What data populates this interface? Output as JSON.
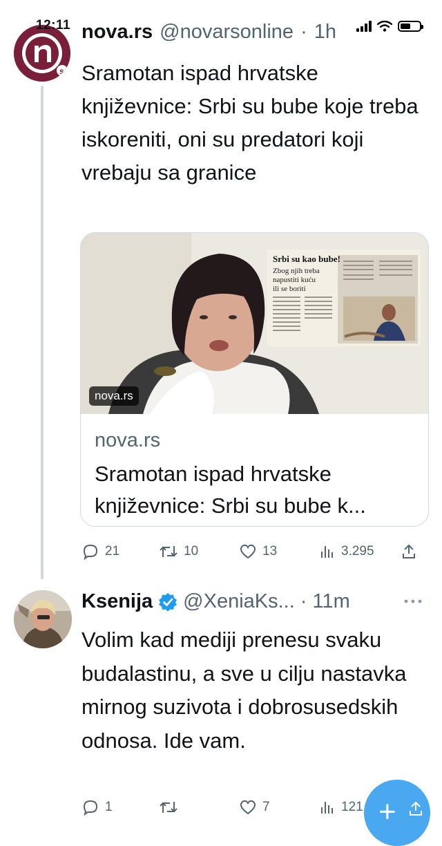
{
  "status_bar": {
    "time": "12:11"
  },
  "tweet1": {
    "name": "nova.rs",
    "handle": "@novarsonline",
    "sep": "·",
    "age": "1h",
    "text": "Sramotan ispad hrvatske književnice: Srbi su bube koje treba iskoreniti, oni su predatori koji vrebaju sa granice",
    "card": {
      "image_badge": "nova.rs",
      "domain": "nova.rs",
      "title": "Sramotan ispad hrvatske književnice: Srbi su bube k...",
      "newspaper_headline": "Srbi su kao bube!",
      "newspaper_sub": "Zbog njih treba napustiti kuću ili se boriti"
    },
    "actions": {
      "replies": "21",
      "retweets": "10",
      "likes": "13",
      "views": "3.295"
    }
  },
  "tweet2": {
    "name": "Ksenija",
    "handle": "@XeniaKs...",
    "sep": "·",
    "age": "11m",
    "text": "Volim kad mediji prenesu svaku budalastinu, a sve u cilju nastavka mirnog suzivota i dobrosusedskih odnosa. Ide vam.",
    "actions": {
      "replies": "1",
      "retweets": "",
      "likes": "7",
      "views": "121"
    }
  },
  "colors": {
    "verified": "#1d9bf0",
    "fab": "#4aa8f0",
    "muted": "#536471",
    "nova_brand": "#7a1f3a"
  },
  "icons": [
    "reply-icon",
    "retweet-icon",
    "like-icon",
    "views-icon",
    "share-icon",
    "more-icon",
    "verified-icon",
    "compose-icon"
  ]
}
